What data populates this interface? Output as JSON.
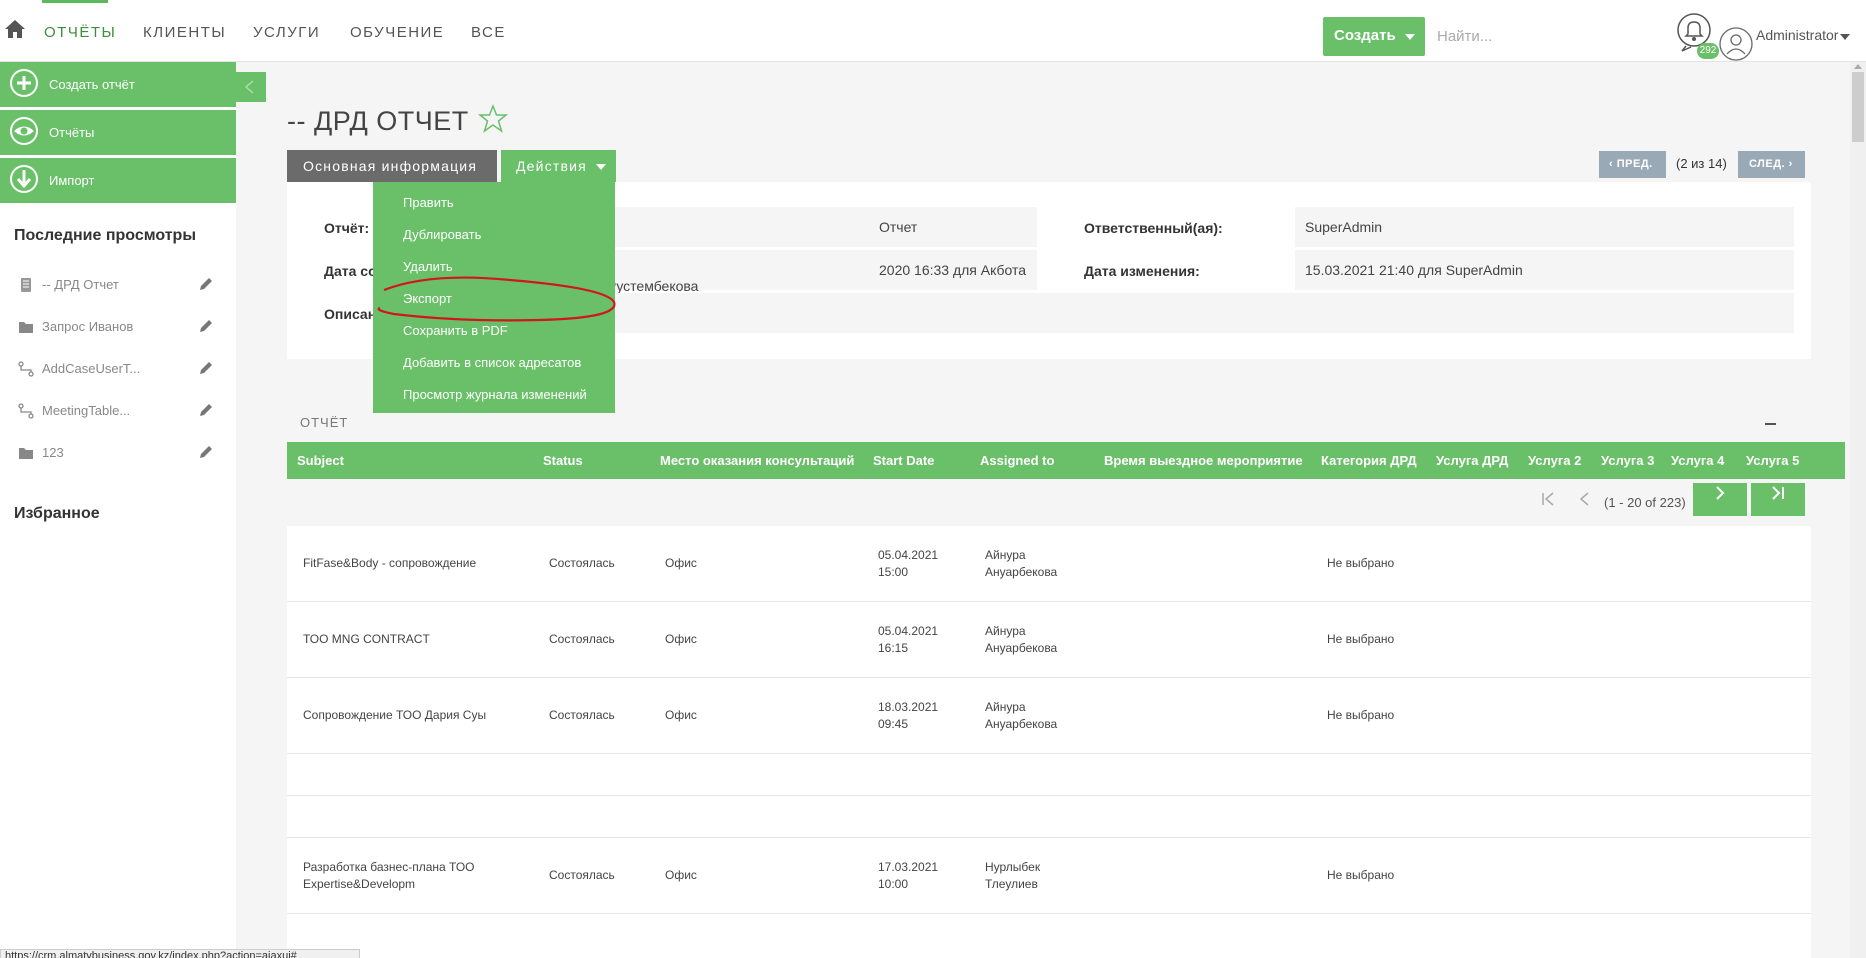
{
  "nav": {
    "tabs": [
      "ОТЧЁТЫ",
      "КЛИЕНТЫ",
      "УСЛУГИ",
      "ОБУЧЕНИЕ",
      "ВСЕ"
    ],
    "create_label": "Создать",
    "search_placeholder": "Найти...",
    "notification_count": "292",
    "user_name": "Administrator"
  },
  "sidebar": {
    "actions": [
      {
        "label": "Создать отчёт",
        "icon": "plus-circle-icon"
      },
      {
        "label": "Отчёты",
        "icon": "eye-icon"
      },
      {
        "label": "Импорт",
        "icon": "download-arrow-icon"
      }
    ],
    "recent_heading": "Последние просмотры",
    "recent": [
      {
        "label": "-- ДРД Отчет",
        "icon": "report-icon"
      },
      {
        "label": "Запрос Иванов",
        "icon": "folder-icon"
      },
      {
        "label": "AddCaseUserT...",
        "icon": "workflow-icon"
      },
      {
        "label": "MeetingTable...",
        "icon": "workflow-icon"
      },
      {
        "label": "123",
        "icon": "folder-icon"
      }
    ],
    "favorites_heading": "Избранное"
  },
  "record": {
    "title": "-- ДРД ОТЧЕТ",
    "tab_main": "Основная информация",
    "tab_actions": "Действия",
    "prev_label": "ПРЕД.",
    "next_label": "СЛЕД.",
    "position": "(2 из 14)",
    "fields": {
      "report_label": "Отчёт:",
      "report_value_visible": "Отчет",
      "created_label_visible": "Дата со",
      "created_value_visible": "2020 16:33 для Акбота Рустембекова",
      "desc_label_visible": "Описан",
      "owner_label": "Ответственный(ая):",
      "owner_value": "SuperAdmin",
      "modified_label": "Дата изменения:",
      "modified_value": "15.03.2021 21:40 для SuperAdmin"
    }
  },
  "actions_menu": [
    "Править",
    "Дублировать",
    "Удалить",
    "Экспорт",
    "Сохранить в PDF",
    "Добавить в список адресатов",
    "Просмотр журнала изменений"
  ],
  "report": {
    "section_title": "ОТЧЁТ",
    "columns": [
      "Subject",
      "Status",
      "Место оказания консультаций",
      "Start Date",
      "Assigned to",
      "Время выездное мероприятие",
      "Категория ДРД",
      "Услуга ДРД",
      "Услуга 2",
      "Услуга 3",
      "Услуга 4",
      "Услуга 5"
    ],
    "pager_info": "(1 - 20 of 223)",
    "rows": [
      {
        "subject": "FitFase&Body - сопровождение",
        "status": "Состоялась",
        "place": "Офис",
        "date": "05.04.2021",
        "time": "15:00",
        "assigned1": "Айнура",
        "assigned2": "Ануарбекова",
        "category": "Не выбрано"
      },
      {
        "subject": "ТОО MNG CONTRACT",
        "status": "Состоялась",
        "place": "Офис",
        "date": "05.04.2021",
        "time": "16:15",
        "assigned1": "Айнура",
        "assigned2": "Ануарбекова",
        "category": "Не выбрано"
      },
      {
        "subject": "Сопровождение ТОО Дария Суы",
        "status": "Состоялась",
        "place": "Офис",
        "date": "18.03.2021",
        "time": "09:45",
        "assigned1": "Айнура",
        "assigned2": "Ануарбекова",
        "category": "Не выбрано"
      },
      {
        "subject": "Разработка базнес-плана ТОО Expertise&Developm",
        "status": "Состоялась",
        "place": "Офис",
        "date": "17.03.2021",
        "time": "10:00",
        "assigned1": "Нурлыбек",
        "assigned2": "Тлеулиев",
        "category": "Не выбрано"
      }
    ]
  },
  "statusbar": "https://crm.almatybusiness.gov.kz/index.php?action=ajaxui#",
  "colors": {
    "accent": "#6abf69",
    "tab_dark": "#6b6b6b",
    "pager_btn": "#9aa9b6",
    "annotation": "#d0171b"
  }
}
